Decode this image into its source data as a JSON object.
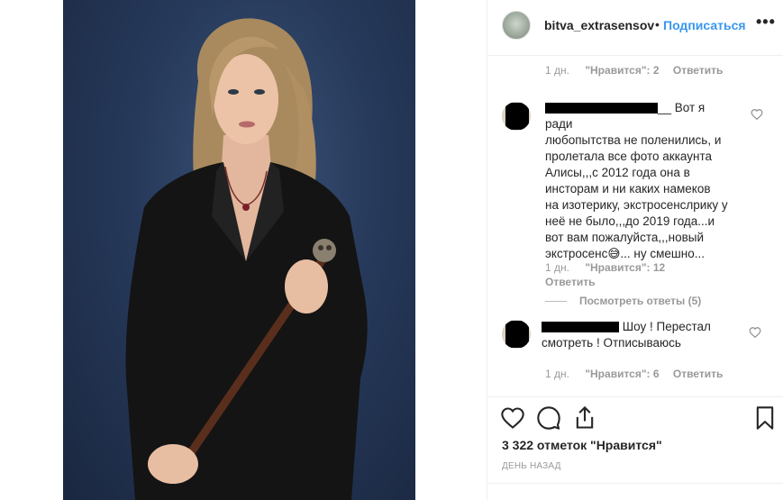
{
  "post": {
    "username": "bitva_extrasensov_t",
    "dot": "•",
    "follow_label": "Подписаться",
    "more_label": "•••",
    "likes": "3 322 отметок \"Нравится\"",
    "posted_time": "ДЕНЬ НАЗАД"
  },
  "comments": [
    {
      "text": "",
      "age": "1 дн.",
      "likes": "\"Нравится\": 2",
      "reply": "Ответить"
    },
    {
      "lines": [
        "Вот я ради",
        "любопытства не поленились, и",
        "пролетала все фото аккаунта",
        "Алисы,,,с 2012 года она в",
        "инсторам и ни каких намеков",
        "на изотерику, экстросенслрику у",
        "неё не было,,,до 2019 года...и",
        "вот вам пожалуйста,,,новый",
        "экстросенс😅... ну смешно..."
      ],
      "age": "1 дн.",
      "likes": "\"Нравится\": 12",
      "reply": "Ответить",
      "view_replies": "Посмотреть ответы (5)"
    },
    {
      "lines": [
        "Шоу ! Перестал",
        "смотреть ! Отписываюсь"
      ],
      "age": "1 дн.",
      "likes": "\"Нравится\": 6",
      "reply": "Ответить"
    }
  ],
  "icons": {
    "like": "heart-icon",
    "comment": "comment-bubble-icon",
    "share": "share-icon",
    "save": "bookmark-icon"
  },
  "colors": {
    "accent": "#3897f0",
    "muted": "#999999",
    "text": "#262626"
  }
}
